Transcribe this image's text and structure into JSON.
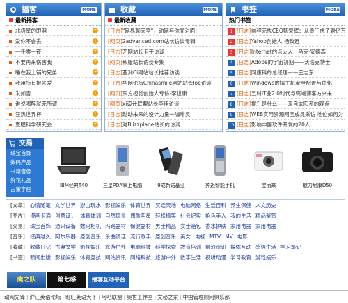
{
  "colors": {
    "accent": "#1f62b6",
    "header_gradient_top": "#4a8fd8",
    "orange": "#e35b00",
    "link_blue": "#1d3f9a"
  },
  "more_label": "MORE",
  "blogger": {
    "title": "播客",
    "subtitle": "最新播客",
    "items": [
      "北极星的眼泪",
      "爱你不会丢",
      "一千零一夜",
      "不要再来伤害我",
      "睡在我上铺的兄弟",
      "我用所有报答爱",
      "发如雪",
      "谁说喝醉就无所谓",
      "狂热世界杯",
      "夏眠科学研究会"
    ]
  },
  "favorites": {
    "title": "收藏",
    "subtitle": "最新收藏",
    "items": [
      {
        "tag": "[日志]",
        "text": "\"网易聊天室\"，动网与你面对面!"
      },
      {
        "tag": "[网页]",
        "text": "2advanced.com站长访谈专辑"
      },
      {
        "tag": "[日志]",
        "text": "艺网站长卡子访谈"
      },
      {
        "tag": "[网页]",
        "text": "私服站长访谈专集"
      },
      {
        "tag": "[日志]",
        "text": "亚洲Ci网站站长推荐访谈"
      },
      {
        "tag": "[日志]",
        "text": "华网论坛Chinasmile网站站长Joe访谈"
      },
      {
        "tag": "[网页]",
        "text": "东方视觉创始人专访-李世康"
      },
      {
        "tag": "[网页]",
        "text": "xi设计联盟站长李佳访谈"
      },
      {
        "tag": "[日志]",
        "text": "越动未来的设计力量一咖啡灵"
      },
      {
        "tag": "[日志]",
        "text": "对Blizzplane站长的访谈"
      }
    ]
  },
  "bookmarks": {
    "title": "书签",
    "subtitle": "热门书签",
    "items": [
      {
        "n": "1",
        "tag": "[日志]",
        "text": "前程无忧CEO甄荣辉：从贵门虎子到亿万"
      },
      {
        "n": "2",
        "tag": "[日志]",
        "text": "Yahoo创始人 杨致远"
      },
      {
        "n": "3",
        "tag": "[日志]",
        "text": "Internet的点火人：马克·安德森"
      },
      {
        "n": "4",
        "tag": "[日志]",
        "text": "Adobe的宇宙初期——沃洛克博士"
      },
      {
        "n": "5",
        "tag": "[日志]",
        "text": "网康科的总经理——王志东"
      },
      {
        "n": "6",
        "tag": "[日志]",
        "text": "Windows虚拟主机安全配置与优化"
      },
      {
        "n": "7",
        "tag": "[日志]",
        "text": "五时IT业2.0时代与高端博客方兴未"
      },
      {
        "n": "8",
        "tag": "[日志]",
        "text": "提升是什么——来自太阳系的观点"
      },
      {
        "n": "9",
        "tag": "[日志]",
        "text": "WEB实用资源网团成员采访 地位如何为"
      },
      {
        "n": "10",
        "tag": "[日志]",
        "text": "影响中国软件开发的20人"
      }
    ]
  },
  "trade": {
    "title": "交易",
    "links": [
      "珠宝首饰",
      "数码产品",
      "书籍音像",
      "鲜花礼品",
      "古董字画"
    ],
    "products": [
      {
        "name": "IBM经典T40",
        "icon": "laptop-icon"
      },
      {
        "name": "三星PDA掌上电脑",
        "icon": "pda-icon"
      },
      {
        "name": "9成新诺基亚",
        "icon": "flip-phone-icon"
      },
      {
        "name": "奔迈智能手机",
        "icon": "smartphone-icon"
      },
      {
        "name": "宝丽来",
        "icon": "polaroid-camera-icon"
      },
      {
        "name": "魅力尼康D50",
        "icon": "dslr-camera-icon"
      }
    ]
  },
  "directory": [
    {
      "label": "[文章]",
      "items": [
        "心情随笔",
        "文学世界",
        "游山玩水",
        "影视娱乐",
        "体育世界",
        "买话天地",
        "电脑网络",
        "生活百科",
        "养生保健",
        "人文历史"
      ]
    },
    {
      "label": "[图片]",
      "items": [
        "漫画卡通",
        "创意设计",
        "体育体训",
        "自然风景",
        "偶像明星",
        "轻松搞笑",
        "社会纪实",
        "艳色美人",
        "我的生活",
        "精品鉴赏"
      ]
    },
    {
      "label": "[交易]",
      "items": [
        "珠宝首饰",
        "通讯设备",
        "数码相机",
        "玛路器材",
        "保健器材",
        "男士精品",
        "女士箱包",
        "香水护肤",
        "家用电器",
        "家用电器"
      ]
    },
    {
      "label": "[音乐]",
      "items": [
        "经典越久",
        "阿尔乐器",
        "原创音乐",
        "乐曲调话",
        "流行歌手",
        "原创音乐",
        "美女",
        "电视",
        "MTV",
        "MV",
        "电影"
      ]
    },
    {
      "label": "[收藏]",
      "items": [
        "收藏日记",
        "古典文学",
        "影视娱乐",
        "旅游户外",
        "电脑科技",
        "科学探索",
        "教育培训",
        "前沿资讯",
        "媒体互动",
        "感悟生活",
        "学习笔记"
      ]
    },
    {
      "label": "[书签]",
      "items": [
        "新闻出版",
        "影视娱乐",
        "体育竞技",
        "网站资讯",
        "网络科技",
        "旅游户外",
        "数字生活",
        "视听动漫",
        "学习教育",
        "游戏娱乐"
      ]
    }
  ],
  "banner": {
    "label1": "鹰之队",
    "label2": "第七感",
    "label3": "播客互动平台"
  },
  "footer": [
    "动网先锋",
    "沪江英语论坛",
    "旺旺英语天下",
    "阿吧联盟",
    "奥世工作室",
    "文秘之家",
    "中国管理顾问俱乐部"
  ]
}
